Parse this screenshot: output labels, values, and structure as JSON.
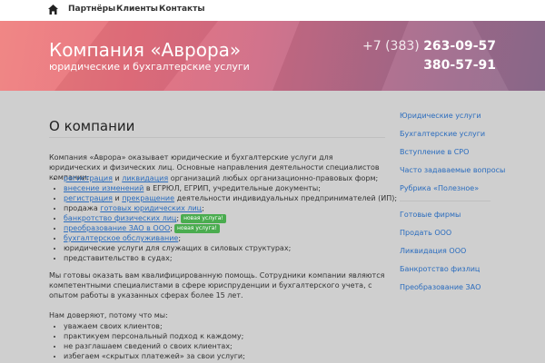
{
  "nav": {
    "home_icon": "home-icon",
    "items": [
      "Партнёры",
      "Клиенты",
      "Контакты"
    ]
  },
  "header": {
    "company": "Компания «Аврора»",
    "tagline": "юридические и бухгалтерские услуги",
    "phone_code": "+7 (383)",
    "phone_number": "263-09-57",
    "phone_second": "380-57-91"
  },
  "main": {
    "title": "О компании",
    "intro": "Компания «Аврора» оказывает юридические и бухгалтерские услуги для юридических и физических лиц. Основные направления деятельности специалистов компании:",
    "services": [
      {
        "link1": "регистрация",
        "and": " и ",
        "link2": "ликвидация",
        "rest": " организаций любых организационно-правовых форм;"
      },
      {
        "link1": "внесение изменений",
        "rest": " в ЕГРЮЛ, ЕГРИП, учредительные документы;"
      },
      {
        "link1": "регистрация",
        "and": " и ",
        "link2": "прекращение",
        "rest": " деятельности индивидуальных предпринимателей (ИП);"
      },
      {
        "pre": "продажа ",
        "link1": "готовых юридических лиц",
        "rest": ";"
      },
      {
        "link1": "банкротство физических лиц",
        "rest": ";",
        "badge": "новая услуга!"
      },
      {
        "link1": "преобразование ЗАО в ООО",
        "rest": ";",
        "badge": "новая услуга!"
      },
      {
        "link1": "бухгалтерское обслуживание",
        "rest": ";"
      },
      {
        "pre": "юридические услуги для служащих в силовых структурах;"
      },
      {
        "pre": "представительство в судах;"
      }
    ],
    "para2": "Мы готовы оказать вам квалифицированную помощь. Сотрудники компании являются компетентными специалистами в сфере юриспруденции и бухгалтерского учета, с опытом работы в указанных сферах более 15 лет.",
    "trust_intro": "Нам доверяют, потому что мы:",
    "trust": [
      "уважаем своих клиентов;",
      "практикуем персональный подход к каждому;",
      "не разглашаем сведений о своих клиентах;",
      "избегаем «скрытых платежей» за свои услуги;"
    ]
  },
  "sidebar": {
    "group1": [
      "Юридические услуги",
      "Бухгалтерские услуги",
      "Вступление в СРО",
      "Часто задаваемые вопросы",
      "Рубрика «Полезное»"
    ],
    "group2": [
      "Готовые фирмы",
      "Продать ООО",
      "Ликвидация ООО",
      "Банкротство физлиц",
      "Преобразование ЗАО"
    ]
  },
  "colors": {
    "link": "#2a6cbe",
    "badge": "#4aac4f",
    "header_gradient_start": "#f0807e",
    "header_gradient_end": "#8d6c8e"
  }
}
